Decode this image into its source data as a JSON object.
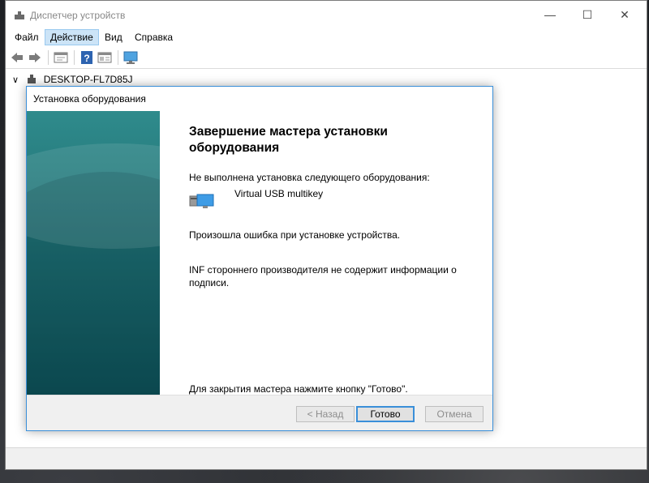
{
  "window": {
    "title": "Диспетчер устройств",
    "controls": {
      "minimize": "—",
      "maximize": "☐",
      "close": "✕"
    }
  },
  "menu": {
    "items": [
      {
        "label": "Файл"
      },
      {
        "label": "Действие",
        "active": true
      },
      {
        "label": "Вид"
      },
      {
        "label": "Справка"
      }
    ]
  },
  "toolbar": {
    "icons": [
      "back-arrow-icon",
      "forward-arrow-icon",
      "properties-icon",
      "help-icon",
      "details-icon",
      "monitor-icon"
    ]
  },
  "tree": {
    "root_label": "DESKTOP-FL7D85J",
    "expander": "∨"
  },
  "dialog": {
    "title": "Установка оборудования",
    "heading": "Завершение мастера установки оборудования",
    "not_installed_text": "Не выполнена установка следующего оборудования:",
    "device_name": "Virtual USB multikey",
    "error_text": "Произошла ошибка при установке устройства.",
    "detail_text": "INF стороннего производителя не содержит информации о подписи.",
    "close_hint": "Для закрытия мастера нажмите кнопку \"Готово\".",
    "buttons": {
      "back": "< Назад",
      "finish": "Готово",
      "cancel": "Отмена"
    }
  },
  "colors": {
    "accent": "#3a8fd9",
    "side_panel": "#1f6f72",
    "menu_active_bg": "#cce4f7"
  }
}
